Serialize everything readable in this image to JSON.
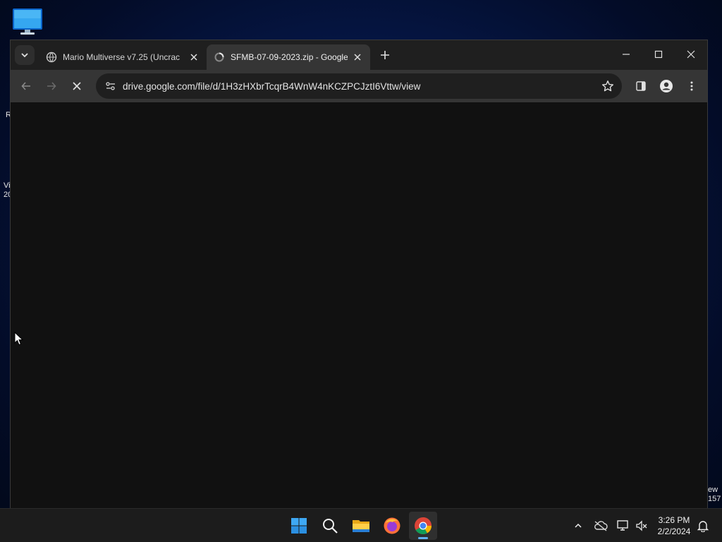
{
  "desktop": {
    "icon_name": "monitor-icon",
    "edge_left_1": "R",
    "edge_left_2": "Vi\n20",
    "edge_right": "ew\n157"
  },
  "browser": {
    "tabs": [
      {
        "title": "Mario Multiverse v7.25 (Uncrac",
        "active": false
      },
      {
        "title": "SFMB-07-09-2023.zip - Google",
        "active": true
      }
    ],
    "url": "drive.google.com/file/d/1H3zHXbrTcqrB4WnW4nKCZPCJztI6Vttw/view",
    "page_loading": true
  },
  "taskbar": {
    "apps": [
      "windows-start-icon",
      "search-icon",
      "file-explorer-icon",
      "firefox-icon",
      "chrome-icon"
    ],
    "active_app": "chrome-icon",
    "time": "3:26 PM",
    "date": "2/2/2024"
  },
  "colors": {
    "accent": "#5fb2f2",
    "toolbar": "#353535",
    "tabstrip": "#1f1f1f",
    "content": "#111111"
  }
}
